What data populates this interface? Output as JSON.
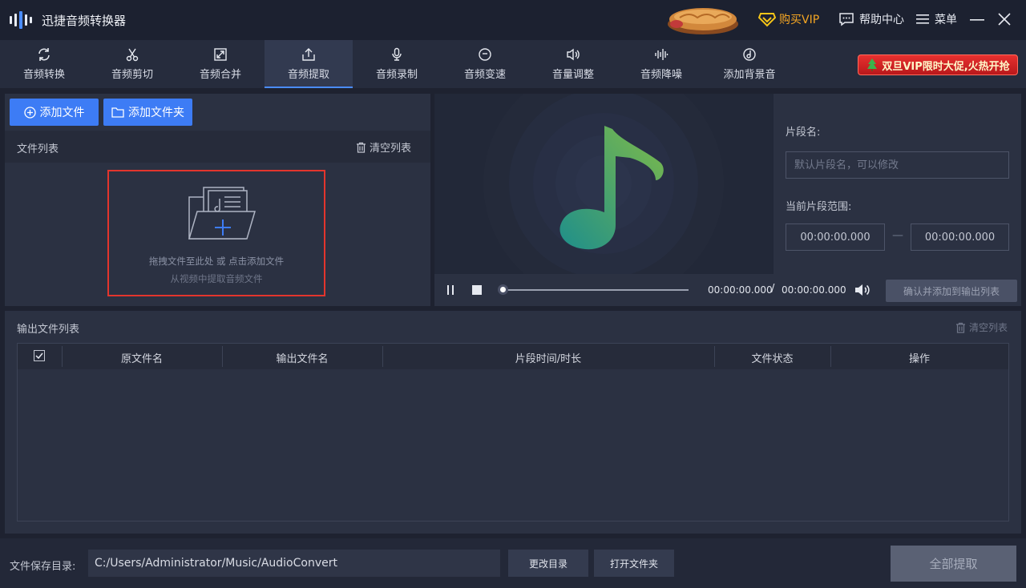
{
  "app": {
    "title": "迅捷音频转换器",
    "vip_label": "购买VIP",
    "help_label": "帮助中心",
    "menu_label": "菜单"
  },
  "toolbar": {
    "tools": [
      {
        "label": "音频转换",
        "icon": "refresh-icon"
      },
      {
        "label": "音频剪切",
        "icon": "scissors-icon"
      },
      {
        "label": "音频合并",
        "icon": "merge-icon"
      },
      {
        "label": "音频提取",
        "icon": "extract-icon"
      },
      {
        "label": "音频录制",
        "icon": "microphone-icon"
      },
      {
        "label": "音频变速",
        "icon": "speed-icon"
      },
      {
        "label": "音量调整",
        "icon": "volume-icon"
      },
      {
        "label": "音频降噪",
        "icon": "waveform-icon"
      },
      {
        "label": "添加背景音",
        "icon": "music-disc-icon"
      }
    ],
    "active_tool": "音频提取",
    "promo_banner": "双旦VIP限时大促,火热开抢"
  },
  "left": {
    "add_file": "添加文件",
    "add_folder": "添加文件夹",
    "file_list_label": "文件列表",
    "clear_list": "清空列表",
    "drop_hint": "拖拽文件至此处 或 点击添加文件",
    "drop_subhint": "从视频中提取音频文件"
  },
  "segment": {
    "name_label": "片段名:",
    "name_placeholder": "默认片段名，可以修改",
    "range_label": "当前片段范围:",
    "range_start": "00:00:00.000",
    "range_dash": "—",
    "range_end": "00:00:00.000"
  },
  "player": {
    "current_time": "00:00:00.000",
    "separator": "/",
    "total_time": "00:00:00.000",
    "confirm_add": "确认并添加到输出列表",
    "progress": 0
  },
  "output": {
    "title": "输出文件列表",
    "clear_list": "清空列表",
    "columns": [
      "原文件名",
      "输出文件名",
      "片段时间/时长",
      "文件状态",
      "操作"
    ],
    "rows": []
  },
  "footer": {
    "save_dir_label": "文件保存目录:",
    "save_dir_value": "C:/Users/Administrator/Music/AudioConvert",
    "change_dir": "更改目录",
    "open_folder": "打开文件夹",
    "extract_all": "全部提取"
  },
  "colors": {
    "accent": "#3d7cf5",
    "drop_border": "#e3352d",
    "vip": "#f5a623"
  }
}
